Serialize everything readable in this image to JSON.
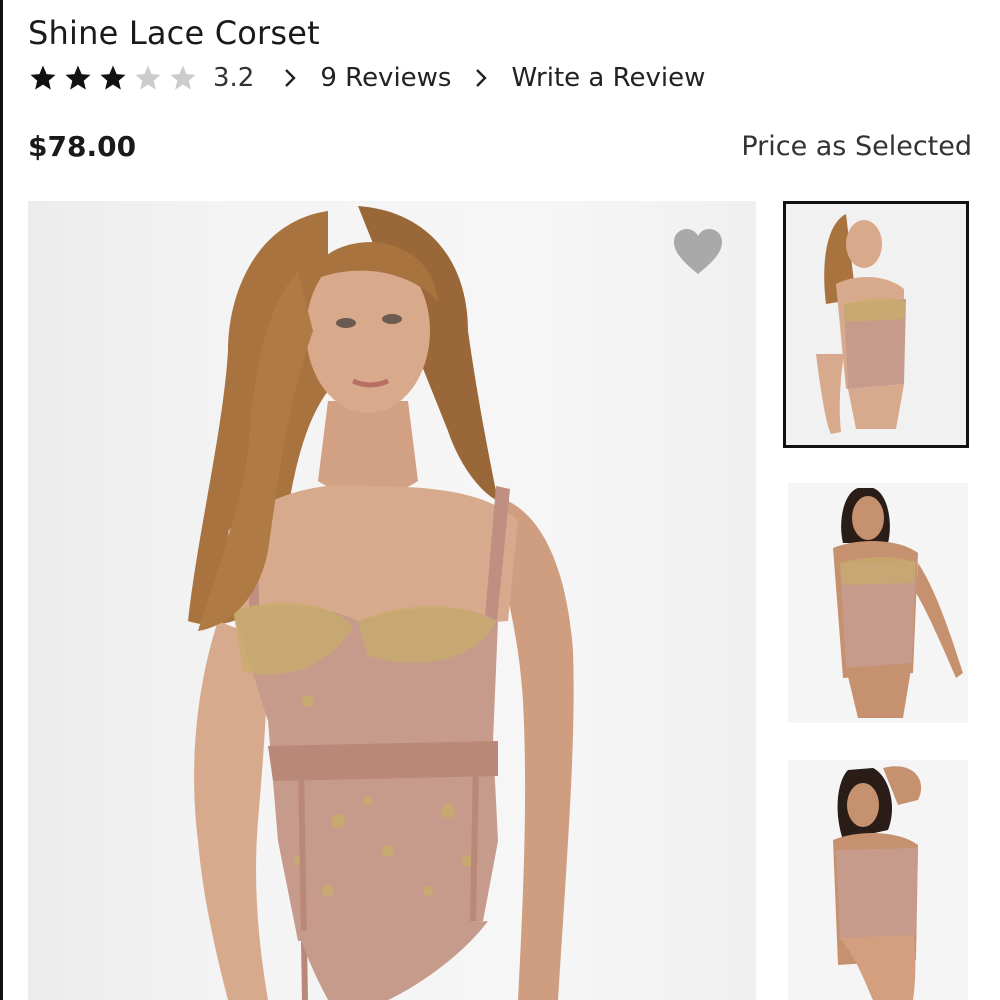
{
  "product": {
    "title": "Shine Lace Corset",
    "rating": {
      "value": 3.2,
      "display": "3.2",
      "max": 5,
      "stars": [
        "full",
        "full",
        "full",
        "empty",
        "empty"
      ]
    },
    "reviews_link": "9 Reviews",
    "write_review_link": "Write a Review",
    "price": "$78.00",
    "price_note": "Price as Selected"
  },
  "gallery": {
    "main_alt": "model wearing lace corset",
    "favorite_icon": "heart-icon",
    "thumbnails": [
      "front view",
      "alternate front view",
      "back view"
    ],
    "selected_index": 0
  },
  "colors": {
    "text": "#1a1a1a",
    "star_filled": "#111111",
    "star_empty": "#cccccc",
    "heart": "#a9a9a9",
    "skin": "#d7a98c",
    "garment": "#c69b8c",
    "gold_lace": "#c8ac6a",
    "hair": "#a8733f"
  }
}
